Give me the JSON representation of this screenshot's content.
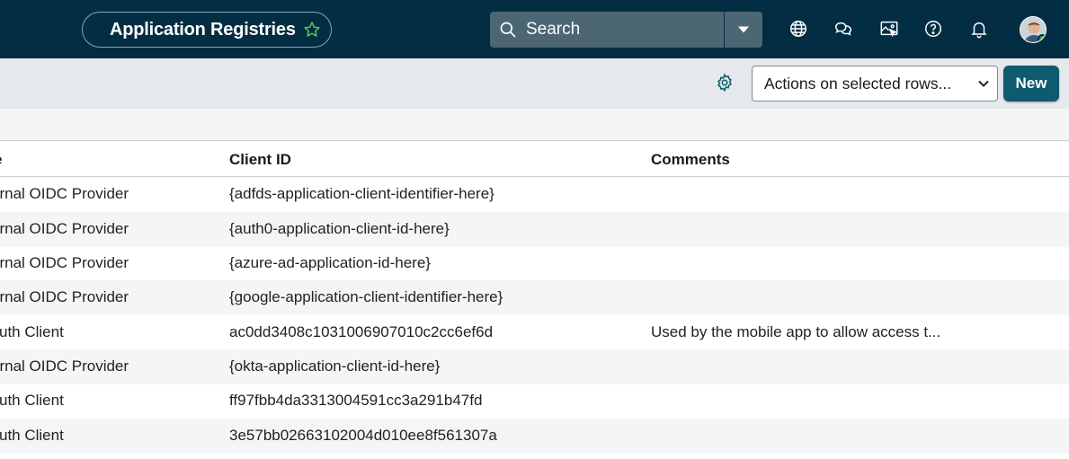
{
  "header": {
    "title": "Application Registries",
    "search_placeholder": "Search",
    "icons": [
      "globe-icon",
      "chat-icon",
      "screen-capture-icon",
      "help-icon",
      "bell-icon"
    ]
  },
  "toolbar": {
    "actions_label": "Actions on selected rows...",
    "new_label": "New"
  },
  "table": {
    "columns": [
      "e",
      "Client ID",
      "Comments"
    ],
    "rows": [
      {
        "type": "ernal OIDC Provider",
        "client_id": "{adfds-application-client-identifier-here}",
        "comments": ""
      },
      {
        "type": "ernal OIDC Provider",
        "client_id": "{auth0-application-client-id-here}",
        "comments": ""
      },
      {
        "type": "ernal OIDC Provider",
        "client_id": "{azure-ad-application-id-here}",
        "comments": ""
      },
      {
        "type": "ernal OIDC Provider",
        "client_id": "{google-application-client-identifier-here}",
        "comments": ""
      },
      {
        "type": "uth Client",
        "client_id": "ac0dd3408c1031006907010c2cc6ef6d",
        "comments": "Used by the mobile app to allow access t..."
      },
      {
        "type": "ernal OIDC Provider",
        "client_id": "{okta-application-client-id-here}",
        "comments": ""
      },
      {
        "type": "uth Client",
        "client_id": "ff97fbb4da3313004591cc3a291b47fd",
        "comments": ""
      },
      {
        "type": "uth Client",
        "client_id": "3e57bb02663102004d010ee8f561307a",
        "comments": ""
      }
    ]
  },
  "colors": {
    "header_bg": "#032d42",
    "toolbar_bg": "#e6e9eb",
    "new_button": "#0e5a70",
    "star": "#5cc45c"
  }
}
